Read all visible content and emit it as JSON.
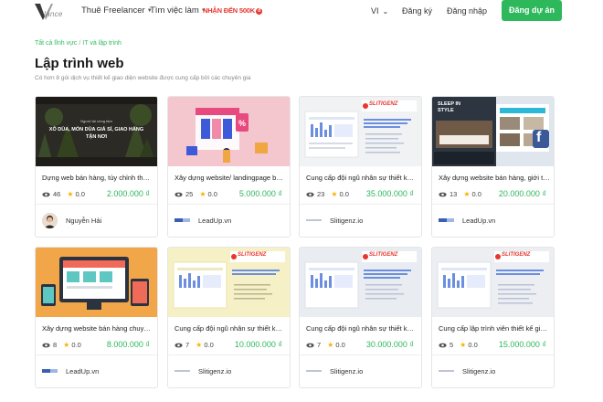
{
  "header": {
    "logo_text": "lance",
    "nav": [
      {
        "label": "Thuê Freelancer"
      },
      {
        "label": "Tìm việc làm"
      }
    ],
    "promo_label": "NHẬN ĐẾN 500K",
    "promo_badge": "đ",
    "language": "VI",
    "register": "Đăng ký",
    "login": "Đăng nhập",
    "post_button": "Đăng dự án"
  },
  "breadcrumb": {
    "items": [
      "Tất cả lĩnh vực",
      "IT và lập trình"
    ],
    "separator": "/"
  },
  "page": {
    "title": "Lập trình web",
    "subtitle": "Có hơn 8 gói dịch vụ thiết kế giao diện website được cung cấp bởi các chuyên gia"
  },
  "banner": {
    "slitigenz_brand": "SLITIGENZ",
    "sleep_line1": "SLEEP IN",
    "sleep_line2": "STYLE",
    "fb_letter": "f",
    "xodua_small": "Người tài xứng tầm",
    "xodua_line1": "XÔ DÙA, MÓN DÙA GIÁ SỈ, GIAO HÀNG",
    "xodua_line2": "TẬN NƠI"
  },
  "cards": [
    {
      "title": "Dựng web bán hàng, tùy chỉnh theo yêu cầu",
      "views": "46",
      "rating": "0.0",
      "price": "2.000.000 ₫",
      "seller": "Nguyễn Hải"
    },
    {
      "title": "Xây dựng website/ landingpage bán hàng",
      "views": "25",
      "rating": "0.0",
      "price": "5.000.000 ₫",
      "seller": "LeadUp.vn"
    },
    {
      "title": "Cung cấp đội ngũ nhân sự thiết kế, xây dựng",
      "views": "23",
      "rating": "0.0",
      "price": "35.000.000 ₫",
      "seller": "Slitigenz.io"
    },
    {
      "title": "Xây dựng website bán hàng, giới thiệu",
      "views": "13",
      "rating": "0.0",
      "price": "20.000.000 ₫",
      "seller": "LeadUp.vn"
    },
    {
      "title": "Xây dựng website bán hàng chuyên nghiệp",
      "views": "8",
      "rating": "0.0",
      "price": "8.000.000 ₫",
      "seller": "LeadUp.vn"
    },
    {
      "title": "Cung cấp đội ngũ nhân sự thiết kế và xây dựng",
      "views": "7",
      "rating": "0.0",
      "price": "10.000.000 ₫",
      "seller": "Slitigenz.io"
    },
    {
      "title": "Cung cấp đội ngũ nhân sự thiết kế, xây dựng",
      "views": "7",
      "rating": "0.0",
      "price": "30.000.000 ₫",
      "seller": "Slitigenz.io"
    },
    {
      "title": "Cung cấp lập trình viên thiết kế giao diện",
      "views": "5",
      "rating": "0.0",
      "price": "15.000.000 ₫",
      "seller": "Slitigenz.io"
    }
  ],
  "colors": {
    "accent": "#2eb85c",
    "promo": "#e8362d",
    "star": "#f5b400"
  }
}
